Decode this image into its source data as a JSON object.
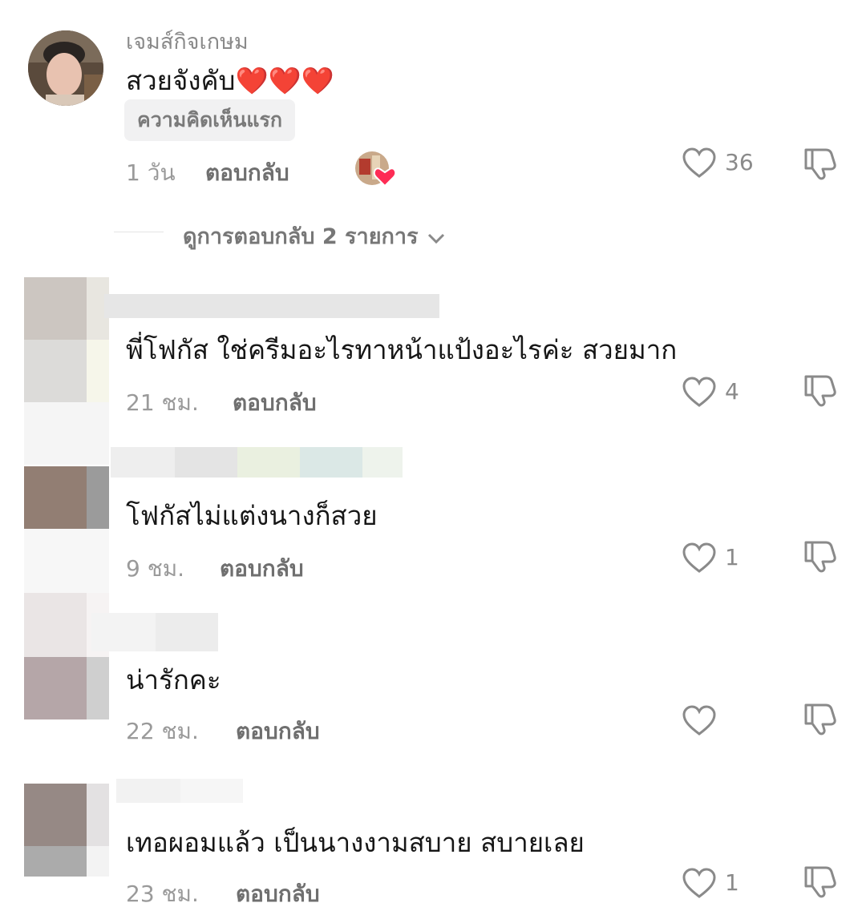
{
  "comments": [
    {
      "username": "เจมส์กิจเกษม",
      "text": "สวยจังคับ",
      "emoji": "❤️❤️❤️",
      "badge": "ความคิดเห็นแรก",
      "time": "1 วัน",
      "reply_label": "ตอบกลับ",
      "likes": "36"
    },
    {
      "username": "",
      "text": "พี่โฟกัส ใช่ครีมอะไรทาหน้าแป้งอะไรค่ะ สวยมาก",
      "time": "21 ชม.",
      "reply_label": "ตอบกลับ",
      "likes": "4"
    },
    {
      "username": "",
      "text": "โฟกัสไม่แต่งนางก็สวย",
      "time": "9 ชม.",
      "reply_label": "ตอบกลับ",
      "likes": "1"
    },
    {
      "username": "",
      "text": "น่ารักคะ",
      "time": "22 ชม.",
      "reply_label": "ตอบกลับ",
      "likes": ""
    },
    {
      "username": "",
      "text": "เทอผอมแล้ว เป็นนางงามสบาย สบายเลย",
      "time": "23 ชม.",
      "reply_label": "ตอบกลับ",
      "likes": "1"
    }
  ],
  "view_replies": "ดูการตอบกลับ 2 รายการ",
  "icons": {
    "like": "heart-outline-icon",
    "dislike": "thumbs-down-outline-icon",
    "chevron": "chevron-down-icon",
    "creator_liked": "creator-liked-heart-icon"
  },
  "colors": {
    "heart_badge": "#fe2c55",
    "text_primary": "#161616",
    "text_secondary": "#8a8a8a"
  }
}
